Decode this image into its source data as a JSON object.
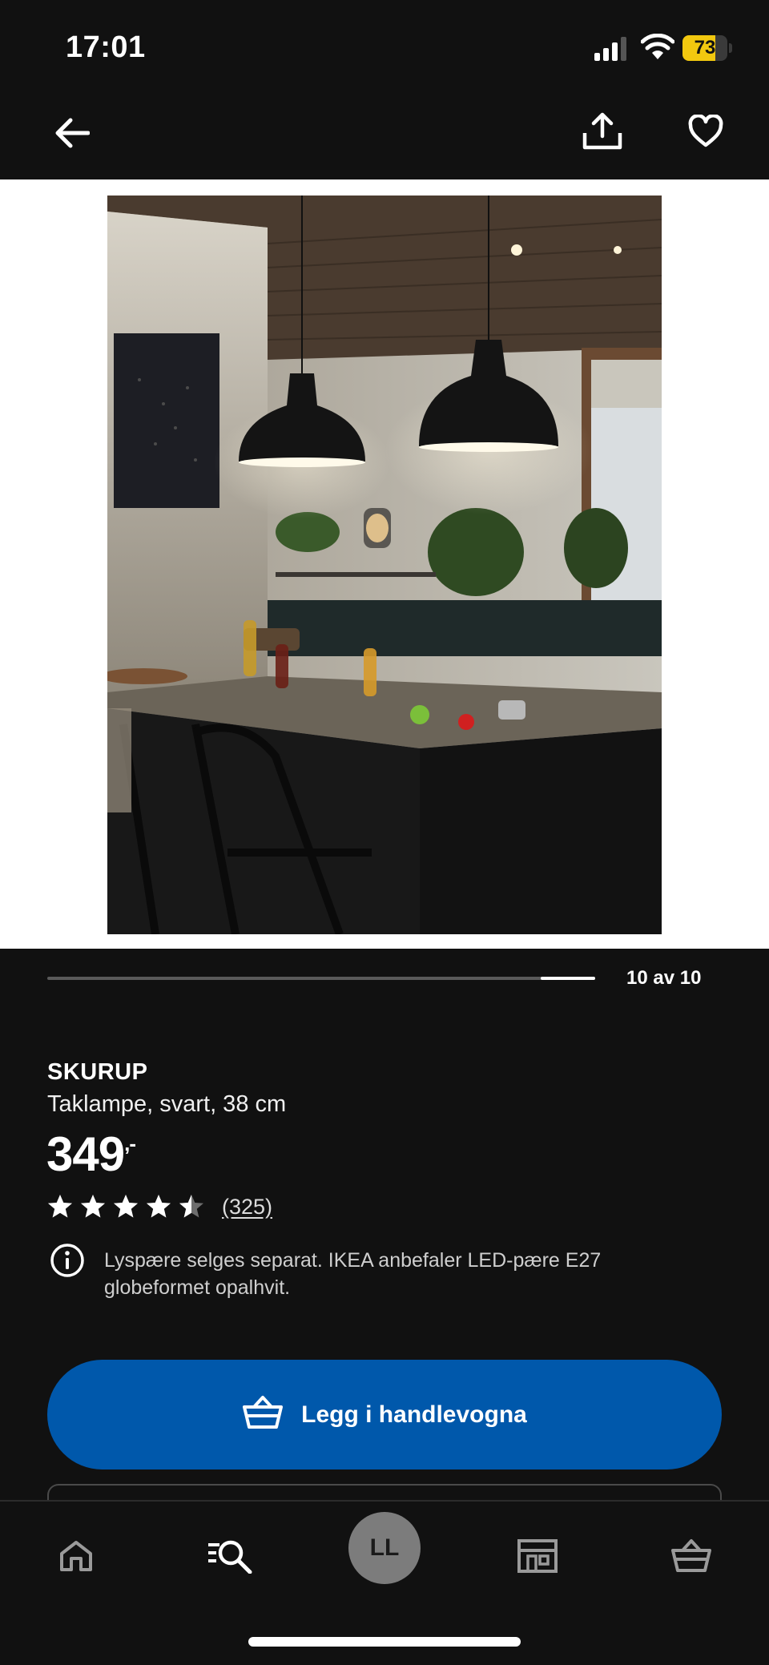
{
  "status_bar": {
    "time": "17:01",
    "battery_level": "73",
    "battery_percent": 73,
    "battery_color": "#f2c80f",
    "icons": [
      "signal-icon",
      "wifi-icon",
      "battery-icon"
    ]
  },
  "top_nav": {
    "icons": [
      "back-arrow-icon",
      "share-icon",
      "heart-icon"
    ]
  },
  "gallery": {
    "counter": "10 av 10",
    "current": 10,
    "total": 10
  },
  "product": {
    "name": "SKURUP",
    "description": "Taklampe, svart, 38 cm",
    "price": "349",
    "price_suffix": ",-",
    "rating": 4.5,
    "rating_max": 5,
    "review_count": "(325)",
    "info_text": "Lyspære selges separat. IKEA anbefaler LED-pære E27 globeformet opalhvit."
  },
  "cart_button": {
    "label": "Legg i handlevogna",
    "color": "#0058ab"
  },
  "tab_bar": {
    "profile_initials": "LL",
    "tabs": [
      "home-icon",
      "search-icon",
      "avatar",
      "store-icon",
      "cart-icon"
    ]
  }
}
